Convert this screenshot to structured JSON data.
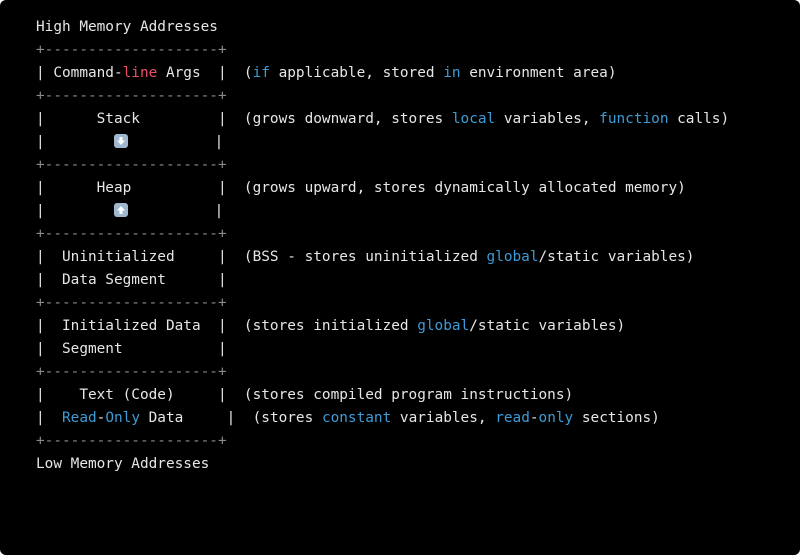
{
  "colors": {
    "background": "#000000",
    "text": "#e6e6e6",
    "keyword": "#3e9bd6",
    "highlight_red": "#ea4f6a",
    "border": "#8a8a8a"
  },
  "lines": [
    [
      {
        "t": "High Memory Addresses",
        "c": "plain"
      }
    ],
    [
      {
        "t": "+--------------------+",
        "c": "dim"
      }
    ],
    [
      {
        "t": "| Command-",
        "c": "plain"
      },
      {
        "t": "line",
        "c": "red"
      },
      {
        "t": " Args  |  (",
        "c": "plain"
      },
      {
        "t": "if",
        "c": "keyword"
      },
      {
        "t": " applicable, stored ",
        "c": "plain"
      },
      {
        "t": "in",
        "c": "keyword"
      },
      {
        "t": " environment area)",
        "c": "plain"
      }
    ],
    [
      {
        "t": "+--------------------+",
        "c": "dim"
      }
    ],
    [
      {
        "t": "|      Stack         |  (grows downward, stores ",
        "c": "plain"
      },
      {
        "t": "local",
        "c": "keyword"
      },
      {
        "t": " variables, ",
        "c": "plain"
      },
      {
        "t": "function",
        "c": "keyword"
      },
      {
        "t": " calls)",
        "c": "plain"
      }
    ],
    [
      {
        "t": "|        ",
        "c": "plain"
      },
      {
        "icon": "down-arrow-icon"
      },
      {
        "t": "          |",
        "c": "plain"
      }
    ],
    [
      {
        "t": "+--------------------+",
        "c": "dim"
      }
    ],
    [
      {
        "t": "|      Heap          |  (grows upward, stores dynamically allocated memory)",
        "c": "plain"
      }
    ],
    [
      {
        "t": "|        ",
        "c": "plain"
      },
      {
        "icon": "up-arrow-icon"
      },
      {
        "t": "          |",
        "c": "plain"
      }
    ],
    [
      {
        "t": "+--------------------+",
        "c": "dim"
      }
    ],
    [
      {
        "t": "|  Uninitialized     |  (BSS - stores uninitialized ",
        "c": "plain"
      },
      {
        "t": "global",
        "c": "keyword"
      },
      {
        "t": "/static variables)",
        "c": "plain"
      }
    ],
    [
      {
        "t": "|  Data Segment      |",
        "c": "plain"
      }
    ],
    [
      {
        "t": "+--------------------+",
        "c": "dim"
      }
    ],
    [
      {
        "t": "|  Initialized Data  |  (stores initialized ",
        "c": "plain"
      },
      {
        "t": "global",
        "c": "keyword"
      },
      {
        "t": "/static variables)",
        "c": "plain"
      }
    ],
    [
      {
        "t": "|  Segment           |",
        "c": "plain"
      }
    ],
    [
      {
        "t": "+--------------------+",
        "c": "dim"
      }
    ],
    [
      {
        "t": "|    Text (Code)     |  (stores compiled program instructions)",
        "c": "plain"
      }
    ],
    [
      {
        "t": "|  ",
        "c": "plain"
      },
      {
        "t": "Read",
        "c": "keyword"
      },
      {
        "t": "-",
        "c": "plain"
      },
      {
        "t": "Only",
        "c": "keyword"
      },
      {
        "t": " Data     |  (stores ",
        "c": "plain"
      },
      {
        "t": "constant",
        "c": "keyword"
      },
      {
        "t": " variables, ",
        "c": "plain"
      },
      {
        "t": "read",
        "c": "keyword"
      },
      {
        "t": "-",
        "c": "plain"
      },
      {
        "t": "only",
        "c": "keyword"
      },
      {
        "t": " sections)",
        "c": "plain"
      }
    ],
    [
      {
        "t": "+--------------------+",
        "c": "dim"
      }
    ],
    [
      {
        "t": "Low Memory Addresses",
        "c": "plain"
      }
    ]
  ]
}
